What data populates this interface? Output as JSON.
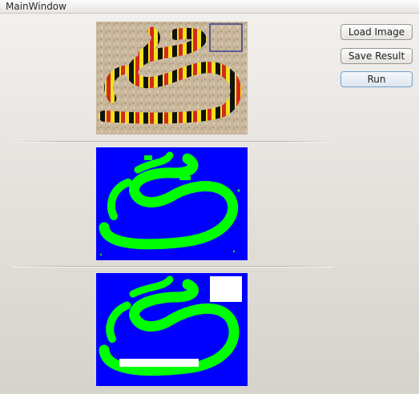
{
  "window": {
    "title": "MainWindow"
  },
  "buttons": {
    "load_label": "Load Image",
    "save_label": "Save Result",
    "run_label": "Run"
  },
  "colors": {
    "mask_background": "#0000ff",
    "mask_foreground": "#00ff00",
    "selection_box": "#1f2a8c",
    "button_focus_border": "#6f9fd1"
  },
  "panels": [
    {
      "name": "original-image",
      "content": "coral snake photo on gravel"
    },
    {
      "name": "segmentation-mask",
      "content": "green snake mask on blue"
    },
    {
      "name": "result-mask",
      "content": "green snake mask on blue with white regions"
    }
  ]
}
